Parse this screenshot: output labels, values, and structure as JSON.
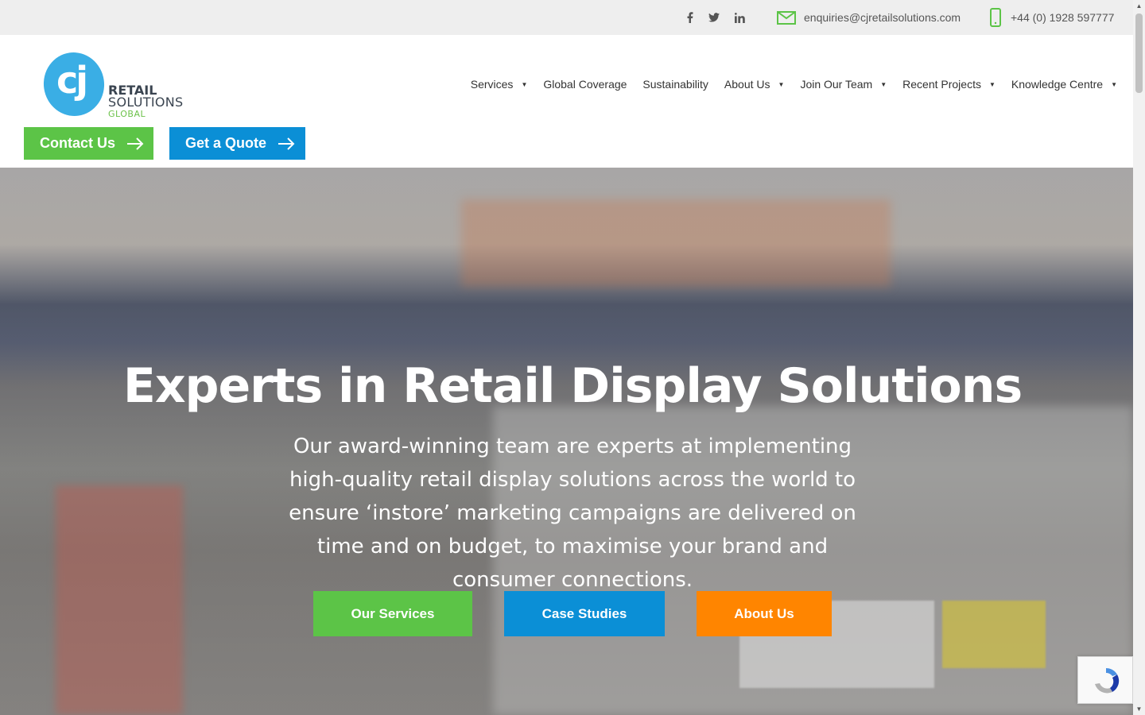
{
  "topbar": {
    "social": [
      "facebook-icon",
      "twitter-icon",
      "linkedin-icon"
    ],
    "email": "enquiries@cjretailsolutions.com",
    "phone": "+44 (0) 1928 597777"
  },
  "logo": {
    "mark": "cj",
    "line1": "RETAIL",
    "line2": "SOLUTIONS",
    "line3": "GLOBAL"
  },
  "nav": {
    "items": [
      {
        "label": "Services",
        "dropdown": true
      },
      {
        "label": "Global Coverage",
        "dropdown": false
      },
      {
        "label": "Sustainability",
        "dropdown": false
      },
      {
        "label": "About Us",
        "dropdown": true
      },
      {
        "label": "Join Our Team",
        "dropdown": true
      },
      {
        "label": "Recent Projects",
        "dropdown": true
      },
      {
        "label": "Knowledge Centre",
        "dropdown": true
      }
    ]
  },
  "cta": {
    "contact": "Contact Us",
    "quote": "Get a Quote"
  },
  "hero": {
    "title": "Experts in Retail Display Solutions",
    "subtitle": "Our award-winning team are experts at implementing high-quality retail display solutions across the world to ensure ‘instore’ marketing campaigns are delivered on time and on budget, to maximise your brand and consumer connections.",
    "buttons": {
      "services": "Our Services",
      "cases": "Case Studies",
      "about": "About Us"
    }
  },
  "colors": {
    "green": "#5cc447",
    "blue": "#0b8fd6",
    "orange": "#ff8500",
    "logo_blue": "#3aaee5"
  }
}
